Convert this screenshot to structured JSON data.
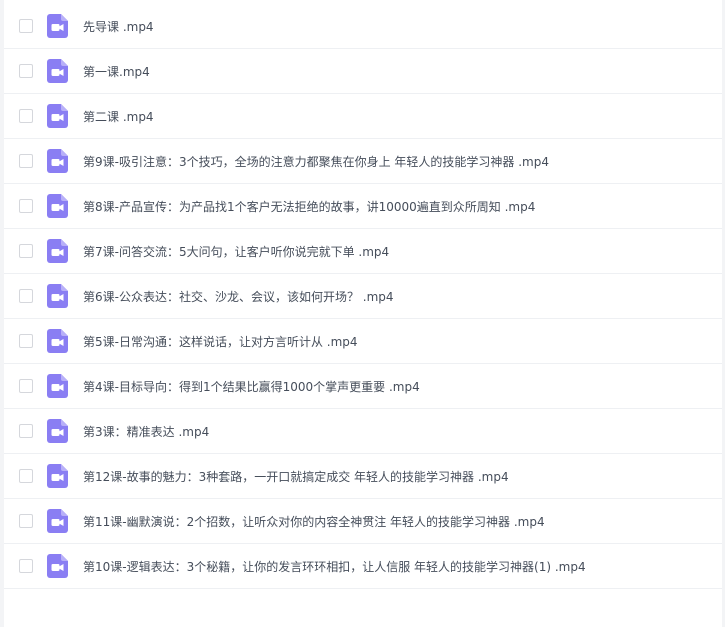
{
  "accent_color": "#8a7ef3",
  "icon": "video-file-icon",
  "files": [
    {
      "name": "先导课 .mp4"
    },
    {
      "name": "第一课.mp4"
    },
    {
      "name": "第二课 .mp4"
    },
    {
      "name": "第9课-吸引注意：3个技巧，全场的注意力都聚焦在你身上 年轻人的技能学习神器 .mp4"
    },
    {
      "name": "第8课-产品宣传：为产品找1个客户无法拒绝的故事，讲10000遍直到众所周知 .mp4"
    },
    {
      "name": "第7课-问答交流：5大问句，让客户听你说完就下单 .mp4"
    },
    {
      "name": "第6课-公众表达：社交、沙龙、会议，该如何开场？ .mp4"
    },
    {
      "name": "第5课-日常沟通：这样说话，让对方言听计从 .mp4"
    },
    {
      "name": "第4课-目标导向：得到1个结果比赢得1000个掌声更重要 .mp4"
    },
    {
      "name": "第3课：精准表达 .mp4"
    },
    {
      "name": "第12课-故事的魅力：3种套路，一开口就搞定成交 年轻人的技能学习神器 .mp4"
    },
    {
      "name": "第11课-幽默演说：2个招数，让听众对你的内容全神贯注 年轻人的技能学习神器 .mp4"
    },
    {
      "name": "第10课-逻辑表达：3个秘籍，让你的发言环环相扣，让人信服 年轻人的技能学习神器(1) .mp4"
    }
  ]
}
